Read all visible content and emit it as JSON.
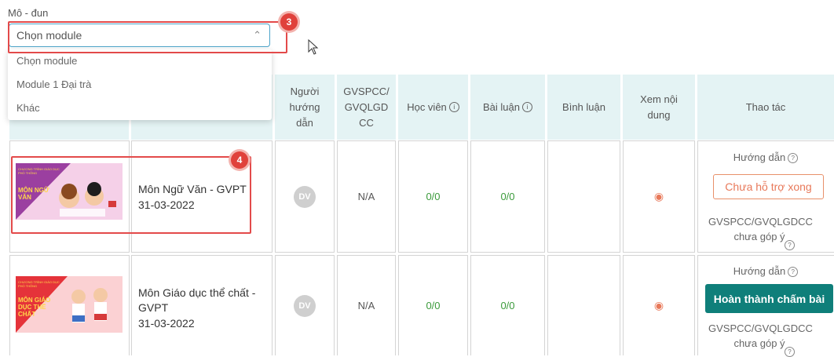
{
  "filter": {
    "label": "Mô - đun",
    "selected": "Chọn module",
    "options": [
      "Chọn module",
      "Module 1 Đại trà",
      "Khác"
    ]
  },
  "callouts": {
    "step3": "3",
    "step4": "4"
  },
  "table": {
    "headers": {
      "guide": "Người hướng dẫn",
      "gvspcc": "GVSPCC/ GVQLGD CC",
      "students": "Học viên",
      "essays": "Bài luận",
      "comments": "Bình luận",
      "view": "Xem nội dung",
      "actions": "Thao tác"
    },
    "rows": [
      {
        "thumb_text": "MÔN NGỮ VĂN",
        "thumb_small": "CHƯƠNG TRÌNH GIÁO DỤC PHỔ THÔNG",
        "title": "Môn Ngữ Văn - GVPT",
        "date": "31-03-2022",
        "guide_initials": "DV",
        "gvspcc": "N/A",
        "students": "0/0",
        "essays": "0/0",
        "action_label": "Hướng dẫn",
        "action_button": "Chưa hỗ trợ xong",
        "feedback_status": "GVSPCC/GVQLGDCC chưa góp ý"
      },
      {
        "thumb_text": "MÔN GIÁO DỤC THỂ CHẤT",
        "thumb_small": "CHƯƠNG TRÌNH GIÁO DỤC PHỔ THÔNG",
        "title": "Môn Giáo dục thể chất - GVPT",
        "date": "31-03-2022",
        "guide_initials": "DV",
        "gvspcc": "N/A",
        "students": "0/0",
        "essays": "0/0",
        "action_label": "Hướng dẫn",
        "action_button": "Hoàn thành chấm bài",
        "feedback_status": "GVSPCC/GVQLGDCC chưa góp ý"
      }
    ]
  },
  "colors": {
    "accent_teal": "#0f7f7a",
    "outline_orange": "#e8795a",
    "header_bg": "#e4f3f4",
    "callout_red": "#e34a4a"
  },
  "icons": [
    "chevron-up-icon",
    "info-icon",
    "eye-icon",
    "question-icon",
    "mouse-cursor-icon"
  ]
}
